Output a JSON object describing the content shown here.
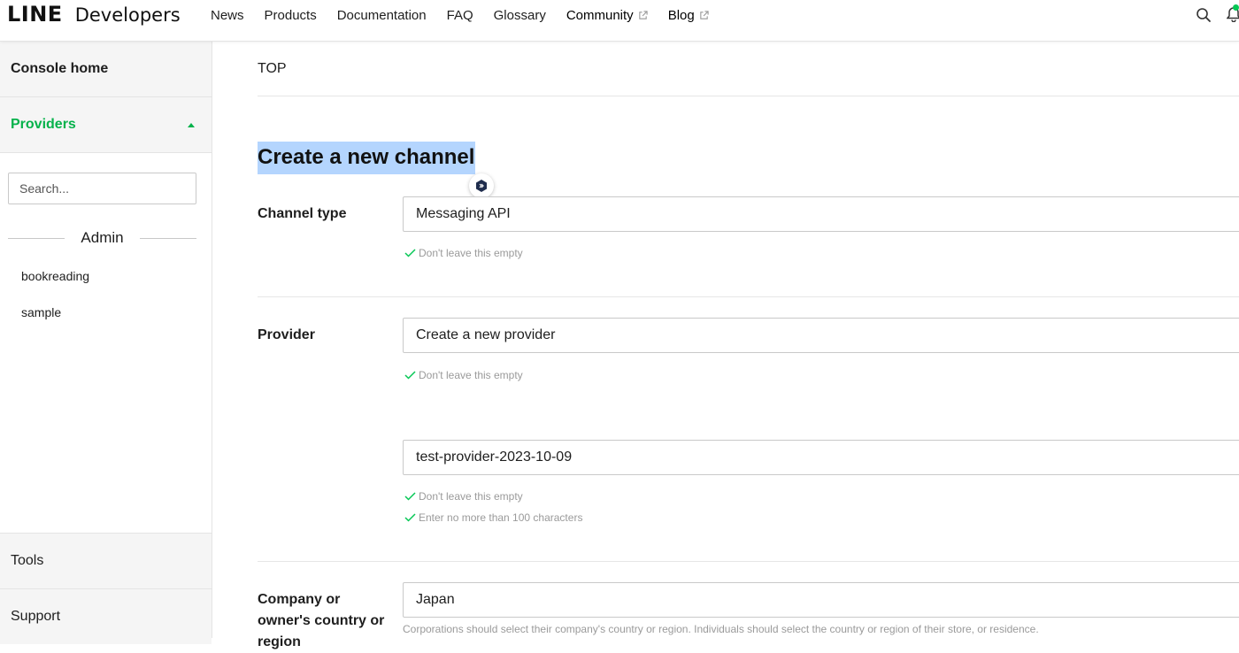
{
  "header": {
    "logo_line": "LINE",
    "logo_dev": "Developers",
    "nav": [
      {
        "label": "News",
        "external": false
      },
      {
        "label": "Products",
        "external": false
      },
      {
        "label": "Documentation",
        "external": false
      },
      {
        "label": "FAQ",
        "external": false
      },
      {
        "label": "Glossary",
        "external": false
      },
      {
        "label": "Community",
        "external": true
      },
      {
        "label": "Blog",
        "external": true
      }
    ],
    "icons": [
      "search-icon",
      "bell-icon"
    ],
    "accent": "#06c755"
  },
  "sidebar": {
    "home": "Console home",
    "providers": "Providers",
    "search_placeholder": "Search...",
    "group_label": "Admin",
    "providers_list": [
      "bookreading",
      "sample"
    ],
    "tools": "Tools",
    "support": "Support"
  },
  "main": {
    "breadcrumb": "TOP",
    "title": "Create a new channel",
    "channel_type": {
      "label": "Channel type",
      "value": "Messaging API",
      "hints": [
        "Don't leave this empty"
      ]
    },
    "provider": {
      "label": "Provider",
      "value": "Create a new provider",
      "hints": [
        "Don't leave this empty"
      ],
      "new_name": "test-provider-2023-10-09",
      "new_name_hints": [
        "Don't leave this empty",
        "Enter no more than 100 characters"
      ]
    },
    "country": {
      "label": "Company or owner's country or region",
      "value": "Japan",
      "note": "Corporations should select their company's country or region. Individuals should select the country or region of their store, or residence."
    }
  }
}
